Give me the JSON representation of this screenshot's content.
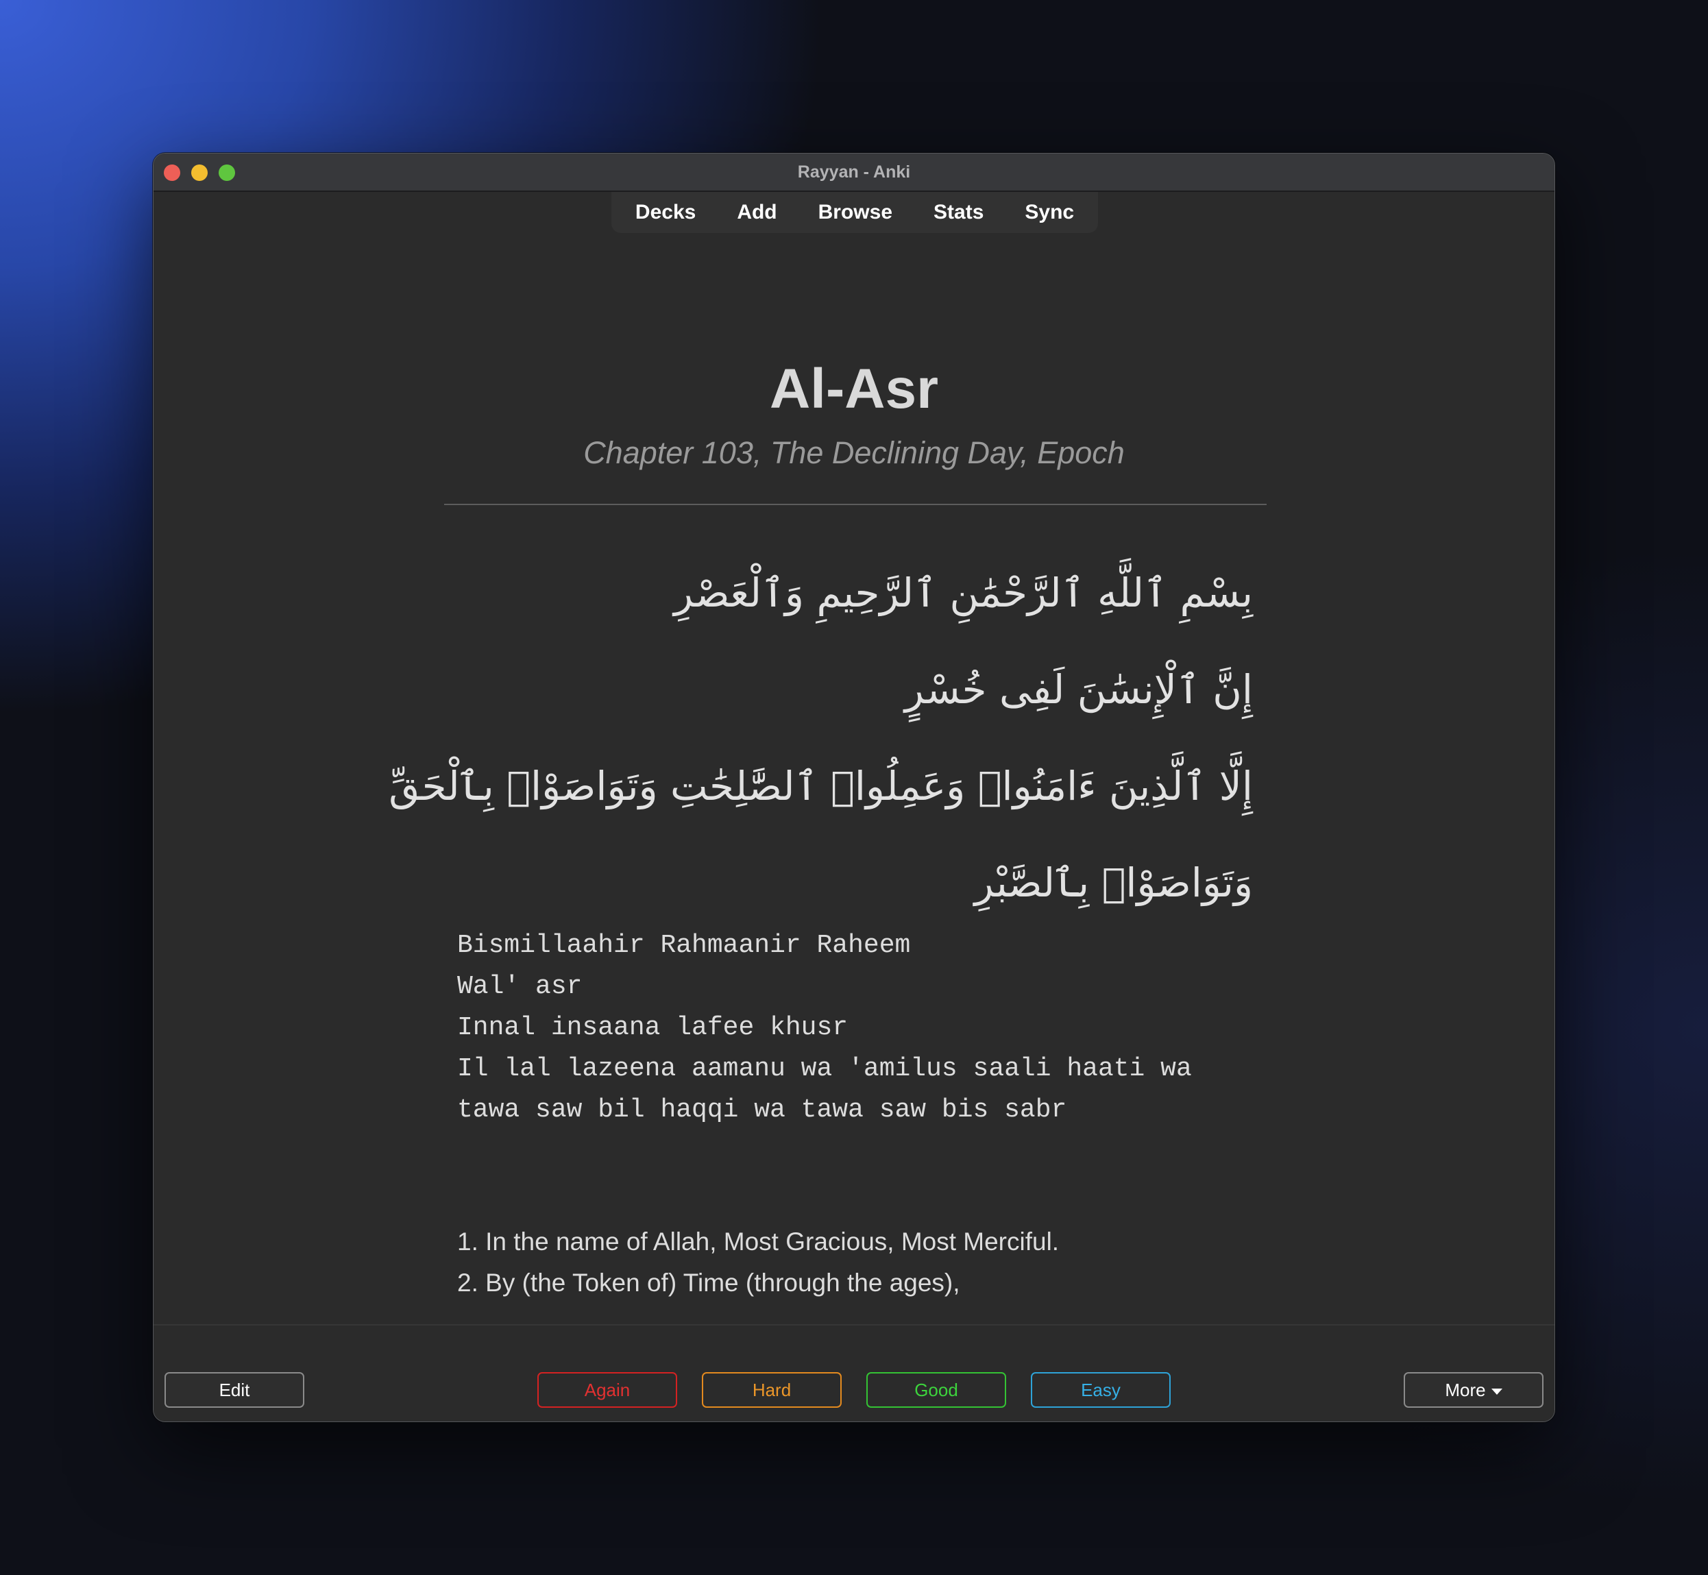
{
  "window": {
    "title": "Rayyan - Anki"
  },
  "toolbar": {
    "items": [
      "Decks",
      "Add",
      "Browse",
      "Stats",
      "Sync"
    ]
  },
  "card": {
    "title": "Al-Asr",
    "subtitle": "Chapter 103, The Declining Day, Epoch",
    "arabic_lines": [
      "بِسْمِ ٱللَّهِ ٱلرَّحْمَٰنِ ٱلرَّحِيمِ وَٱلْعَصْرِ",
      "إِنَّ ٱلْإِنسَٰنَ لَفِى خُسْرٍ",
      "إِلَّا ٱلَّذِينَ ءَامَنُوا۟ وَعَمِلُوا۟ ٱلصَّٰلِحَٰتِ وَتَوَاصَوْا۟ بِٱلْحَقِّ",
      "وَتَوَاصَوْا۟ بِٱلصَّبْرِ"
    ],
    "transliteration_lines": [
      "Bismillaahir Rahmaanir Raheem",
      "Wal' asr",
      "Innal insaana lafee khusr",
      "Il lal lazeena aamanu wa 'amilus saali haati wa",
      "tawa saw bil haqqi wa tawa saw bis sabr"
    ],
    "translation_lines": [
      "1. In the name of Allah, Most Gracious, Most Merciful.",
      "2. By (the Token of) Time (through the ages),"
    ]
  },
  "bottombar": {
    "edit_label": "Edit",
    "again_label": "Again",
    "hard_label": "Hard",
    "good_label": "Good",
    "easy_label": "Easy",
    "more_label": "More"
  },
  "colors": {
    "again": "#e23131",
    "hard": "#eb9629",
    "good": "#3dd43d",
    "easy": "#36b0e6",
    "window_bg": "#2b2b2b"
  }
}
